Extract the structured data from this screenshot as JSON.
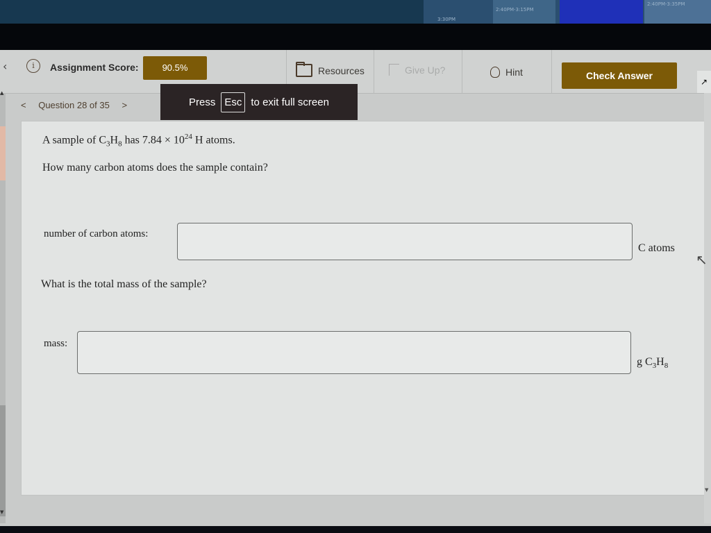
{
  "background": {
    "calendar_times": [
      "3:30PM",
      "2:40PM-3:15PM",
      "2:40PM-3:35PM"
    ]
  },
  "header": {
    "score_label": "Assignment Score:",
    "score_value": "90.5%",
    "resources_label": "Resources",
    "give_up_label": "Give Up?",
    "hint_label": "Hint",
    "check_answer_label": "Check Answer"
  },
  "question_nav": {
    "prev": "<",
    "label": "Question 28 of 35",
    "next": ">"
  },
  "toast": {
    "press": "Press",
    "key": "Esc",
    "rest": "to exit full screen"
  },
  "question": {
    "line1_pre": "A sample of C",
    "line1_sub1": "3",
    "line1_mid": "H",
    "line1_sub2": "8",
    "line1_has": " has 7.84 × 10",
    "line1_exp": "24",
    "line1_post": " H atoms.",
    "line2": "How many carbon atoms does the sample contain?",
    "part1_label": "number of carbon atoms:",
    "part1_value": "",
    "part1_unit": "C atoms",
    "line3": "What is the total mass of the sample?",
    "part2_label": "mass:",
    "part2_value": "",
    "part2_unit_pre": "g C",
    "part2_unit_sub1": "3",
    "part2_unit_mid": "H",
    "part2_unit_sub2": "8"
  },
  "colors": {
    "accent": "#7c5a07",
    "toast_bg": "#2b2425"
  }
}
